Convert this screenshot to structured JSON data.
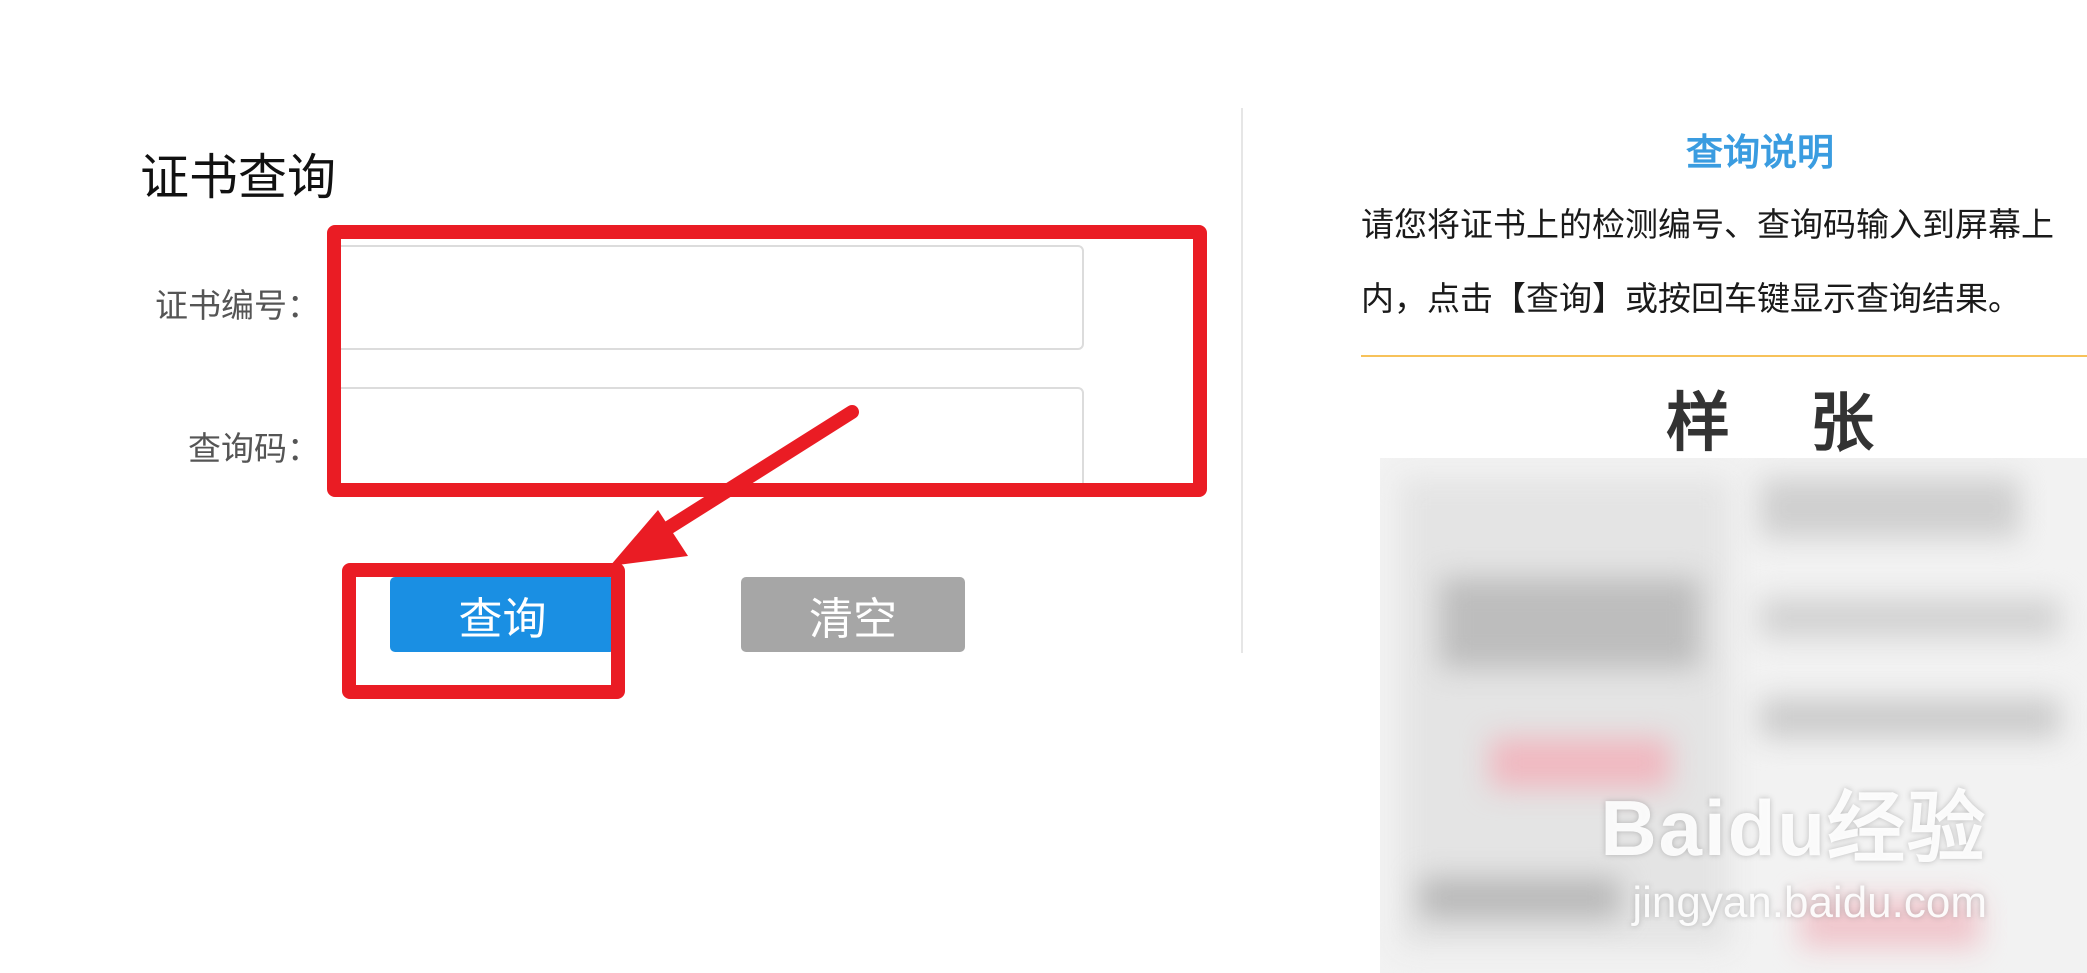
{
  "form": {
    "title": "证书查询",
    "cert_number_label": "证书编号：",
    "query_code_label": "查询码：",
    "cert_number_value": "",
    "query_code_value": "",
    "query_button": "查询",
    "clear_button": "清空"
  },
  "help": {
    "title": "查询说明",
    "line1": "请您将证书上的检测编号、查询码输入到屏幕上",
    "line2": "内，点击【查询】或按回车键显示查询结果。",
    "sample_title": "样张"
  },
  "watermark": {
    "logo": "Baidu经验",
    "url": "jingyan.baidu.com"
  },
  "colors": {
    "accent_blue": "#1a8fe3",
    "help_title_blue": "#3a9ce0",
    "clear_gray": "#a6a6a6",
    "annotation_red": "#ea1c24",
    "rule_yellow": "#f7c25a"
  }
}
